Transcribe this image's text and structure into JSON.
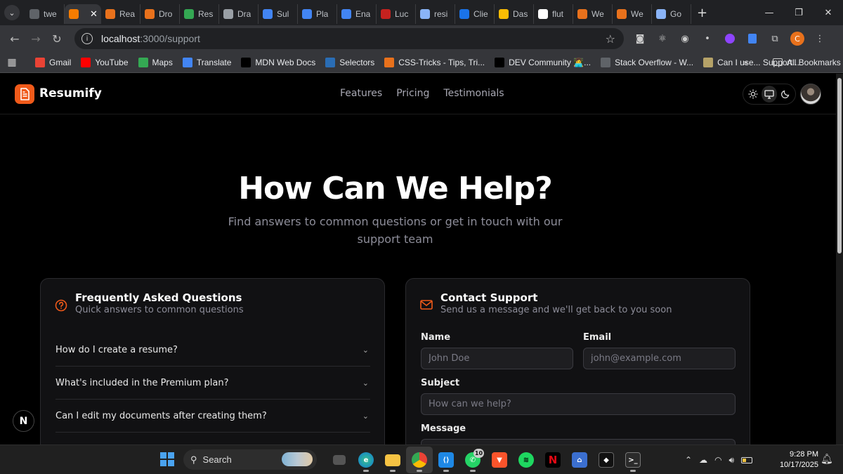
{
  "browser": {
    "tabs": [
      {
        "title": "twe",
        "icon": "globe-icon",
        "color": "#5f6368"
      },
      {
        "title": "",
        "icon": "blogger-icon",
        "color": "#f57c00",
        "active": true
      },
      {
        "title": "Rea",
        "icon": "asterisk-icon",
        "color": "#e8711c"
      },
      {
        "title": "Dro",
        "icon": "asterisk-icon",
        "color": "#e8711c"
      },
      {
        "title": "Res",
        "icon": "pulse-icon",
        "color": "#34a853"
      },
      {
        "title": "Dra",
        "icon": "pen-icon",
        "color": "#9aa0a6"
      },
      {
        "title": "Sul",
        "icon": "doc-icon",
        "color": "#4285f4"
      },
      {
        "title": "Pla",
        "icon": "doc-icon",
        "color": "#4285f4"
      },
      {
        "title": "Ena",
        "icon": "doc-icon",
        "color": "#4285f4"
      },
      {
        "title": "Luc",
        "icon": "spiral-icon",
        "color": "#c5221f"
      },
      {
        "title": "resi",
        "icon": "ai-icon",
        "color": "#8ab4f8"
      },
      {
        "title": "Clie",
        "icon": "shield-icon",
        "color": "#1a73e8"
      },
      {
        "title": "Das",
        "icon": "fox-icon",
        "color": "#fbbc04"
      },
      {
        "title": "flut",
        "icon": "google-icon",
        "color": "#ffffff"
      },
      {
        "title": "We",
        "icon": "fox-icon",
        "color": "#e8711c"
      },
      {
        "title": "We",
        "icon": "fox-icon",
        "color": "#e8711c"
      },
      {
        "title": "Go",
        "icon": "gemini-icon",
        "color": "#8ab4f8"
      }
    ],
    "url_host": "localhost",
    "url_path": ":3000/support",
    "profile_initial": "C",
    "bookmarks": [
      {
        "label": "Gmail",
        "icon": "gmail-icon",
        "color": "#ea4335"
      },
      {
        "label": "YouTube",
        "icon": "youtube-icon",
        "color": "#ff0000"
      },
      {
        "label": "Maps",
        "icon": "maps-icon",
        "color": "#34a853"
      },
      {
        "label": "Translate",
        "icon": "translate-icon",
        "color": "#4285f4"
      },
      {
        "label": "MDN Web Docs",
        "icon": "mdn-icon",
        "color": "#000000"
      },
      {
        "label": "Selectors",
        "icon": "w3-icon",
        "color": "#2a6db5"
      },
      {
        "label": "CSS-Tricks - Tips, Tri...",
        "icon": "asterisk-icon",
        "color": "#e8711c"
      },
      {
        "label": "DEV Community 👩‍💻...",
        "icon": "dev-icon",
        "color": "#000000"
      },
      {
        "label": "Stack Overflow - W...",
        "icon": "globe-icon",
        "color": "#5f6368"
      },
      {
        "label": "Can I use... Support...",
        "icon": "caniuse-icon",
        "color": "#b5a268"
      }
    ],
    "all_bookmarks": "All Bookmarks"
  },
  "site": {
    "brand": "Resumify",
    "nav": [
      "Features",
      "Pricing",
      "Testimonials"
    ],
    "accent": "#f05a1a"
  },
  "hero": {
    "title": "How Can We Help?",
    "subtitle": "Find answers to common questions or get in touch with our support team"
  },
  "faq": {
    "title": "Frequently Asked Questions",
    "description": "Quick answers to common questions",
    "items": [
      "How do I create a resume?",
      "What's included in the Premium plan?",
      "Can I edit my documents after creating them?"
    ]
  },
  "contact": {
    "title": "Contact Support",
    "description": "Send us a message and we'll get back to you soon",
    "name_label": "Name",
    "name_placeholder": "John Doe",
    "email_label": "Email",
    "email_placeholder": "john@example.com",
    "subject_label": "Subject",
    "subject_placeholder": "How can we help?",
    "message_label": "Message"
  },
  "next_badge": "N",
  "taskbar": {
    "search": "Search",
    "whatsapp_badge": "10",
    "time": "9:28 PM",
    "date": "10/17/2025"
  }
}
